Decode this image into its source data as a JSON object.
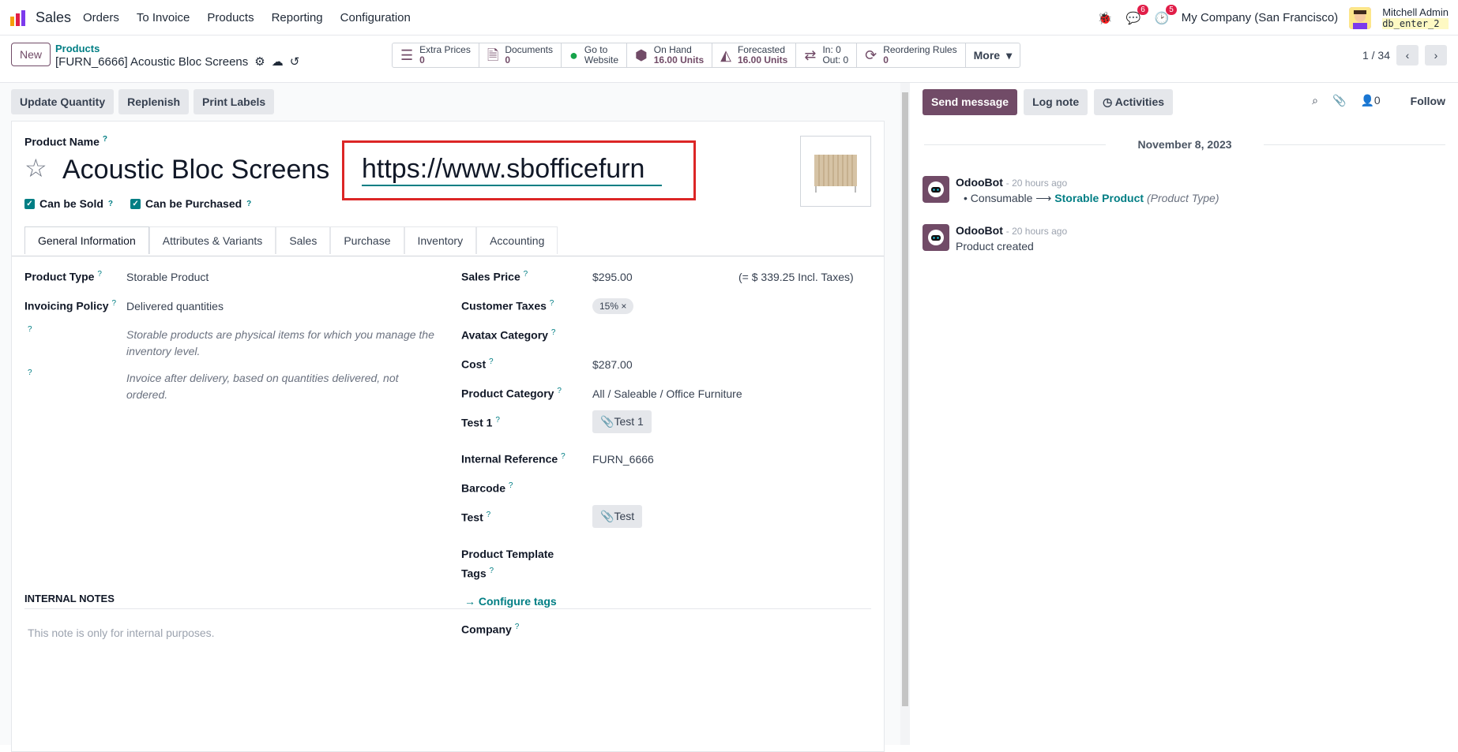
{
  "navbar": {
    "app_name": "Sales",
    "menu": [
      "Orders",
      "To Invoice",
      "Products",
      "Reporting",
      "Configuration"
    ],
    "messages_count": "6",
    "activities_count": "5",
    "company": "My Company (San Francisco)",
    "user_name": "Mitchell Admin",
    "db_name": "db_enter_2"
  },
  "control": {
    "new_label": "New",
    "breadcrumb_parent": "Products",
    "breadcrumb_current": "[FURN_6666] Acoustic Bloc Screens",
    "smart_buttons": [
      {
        "icon": "list-icon",
        "label": "Extra Prices",
        "value": "0"
      },
      {
        "icon": "document-icon",
        "label": "Documents",
        "value": "0"
      },
      {
        "icon": "globe-icon",
        "label": "Go to",
        "value": "Website"
      },
      {
        "icon": "cubes-icon",
        "label": "On Hand",
        "value": "16.00 Units"
      },
      {
        "icon": "area-chart-icon",
        "label": "Forecasted",
        "value": "16.00 Units"
      },
      {
        "icon": "exchange-icon",
        "label": "In: 0",
        "value": "Out: 0"
      },
      {
        "icon": "refresh-icon",
        "label": "Reordering Rules",
        "value": "0"
      }
    ],
    "more_label": "More",
    "pager": "1 / 34"
  },
  "actions": [
    "Update Quantity",
    "Replenish",
    "Print Labels"
  ],
  "form": {
    "product_name_label": "Product Name",
    "product_name": "Acoustic Bloc Screens",
    "url_value": "https://www.sbofficefurn",
    "can_be_sold": "Can be Sold",
    "can_be_purchased": "Can be Purchased",
    "tabs": [
      "General Information",
      "Attributes & Variants",
      "Sales",
      "Purchase",
      "Inventory",
      "Accounting"
    ],
    "product_type_label": "Product Type",
    "product_type": "Storable Product",
    "invoicing_policy_label": "Invoicing Policy",
    "invoicing_policy": "Delivered quantities",
    "help_1": "Storable products are physical items for which you manage the inventory level.",
    "help_2": "Invoice after delivery, based on quantities delivered, not ordered.",
    "sales_price_label": "Sales Price",
    "sales_price": "$295.00",
    "sales_price_incl": "(= $ 339.25 Incl. Taxes)",
    "customer_taxes_label": "Customer Taxes",
    "customer_taxes": "15%",
    "avatax_label": "Avatax Category",
    "cost_label": "Cost",
    "cost": "$287.00",
    "product_category_label": "Product Category",
    "product_category": "All / Saleable / Office Furniture",
    "test1_label": "Test 1",
    "test1_button": "Test 1",
    "internal_ref_label": "Internal Reference",
    "internal_ref": "FURN_6666",
    "barcode_label": "Barcode",
    "test_label": "Test",
    "test_button": "Test",
    "template_tags_label_1": "Product Template",
    "template_tags_label_2": "Tags",
    "configure_tags": "Configure tags",
    "company_label": "Company",
    "internal_notes_header": "INTERNAL NOTES",
    "internal_notes_placeholder": "This note is only for internal purposes."
  },
  "chatter": {
    "send_message": "Send message",
    "log_note": "Log note",
    "activities": "Activities",
    "followers_count": "0",
    "follow": "Follow",
    "date": "November 8, 2023",
    "messages": [
      {
        "author": "OdooBot",
        "ago": "- 20 hours ago",
        "old": "Consumable",
        "new": "Storable Product",
        "field": "(Product Type)"
      },
      {
        "author": "OdooBot",
        "ago": "- 20 hours ago",
        "text": "Product created"
      }
    ]
  }
}
